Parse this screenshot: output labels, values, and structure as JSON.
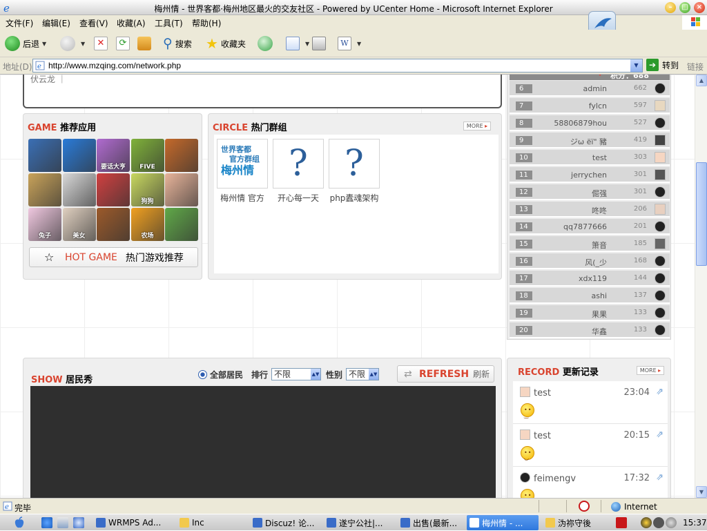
{
  "window": {
    "title": "梅州情 - 世界客都·梅州地区最火的交友社区 - Powered by UCenter Home - Microsoft Internet Explorer"
  },
  "menu": [
    "文件(F)",
    "编辑(E)",
    "查看(V)",
    "收藏(A)",
    "工具(T)",
    "帮助(H)"
  ],
  "toolbar": {
    "back": "后退",
    "search": "搜索",
    "favorites": "收藏夹"
  },
  "address": {
    "label": "地址(D)",
    "url": "http://www.mzqing.com/network.php",
    "go": "转到",
    "links": "链接"
  },
  "page": {
    "top_fragment": "伏云龙 ｜",
    "game": {
      "title_en": "GAME",
      "title_cn": "推荐应用",
      "tiles": [
        {
          "label": "",
          "color": "#3a6fb5"
        },
        {
          "label": "",
          "color": "#2a7bd8"
        },
        {
          "label": "要话大亨",
          "color": "#b06bd0"
        },
        {
          "label": "FIVE",
          "color": "#7fb13a"
        },
        {
          "label": "",
          "color": "#c4692a"
        },
        {
          "label": "",
          "color": "#c9a35a"
        },
        {
          "label": "",
          "color": "#d8d8d8"
        },
        {
          "label": "",
          "color": "#d04040"
        },
        {
          "label": "狗狗",
          "color": "#c8d860"
        },
        {
          "label": "",
          "color": "#e8b49a"
        },
        {
          "label": "兔子",
          "color": "#f0c8e0"
        },
        {
          "label": "美女",
          "color": "#e0d0c0"
        },
        {
          "label": "",
          "color": "#9c5a2a"
        },
        {
          "label": "农场",
          "color": "#f0a020"
        },
        {
          "label": "",
          "color": "#60a848"
        }
      ],
      "hot_en": "HOT GAME",
      "hot_cn": "热门游戏推荐"
    },
    "circle": {
      "title_en": "CIRCLE",
      "title_cn": "热门群组",
      "more": "MORE",
      "groups": [
        {
          "name": "梅州情 官方",
          "logo_line1": "世界客都",
          "logo_line2": "官方群组",
          "logo_line3": "梅州情"
        },
        {
          "name": "开心每一天"
        },
        {
          "name": "php蠹魂架构"
        }
      ]
    },
    "ranking": {
      "header": "积分：688",
      "rows": [
        {
          "rank": "6",
          "name": "admin",
          "score": "662"
        },
        {
          "rank": "7",
          "name": "fylcn",
          "score": "597"
        },
        {
          "rank": "8",
          "name": "58806879hou",
          "score": "527"
        },
        {
          "rank": "9",
          "name": "ジω ëï\" 豬",
          "score": "419"
        },
        {
          "rank": "10",
          "name": "test",
          "score": "303"
        },
        {
          "rank": "11",
          "name": "jerrychen",
          "score": "301"
        },
        {
          "rank": "12",
          "name": "倔强",
          "score": "301"
        },
        {
          "rank": "13",
          "name": "咚咚",
          "score": "206"
        },
        {
          "rank": "14",
          "name": "qq7877666",
          "score": "201"
        },
        {
          "rank": "15",
          "name": "箫音",
          "score": "185"
        },
        {
          "rank": "16",
          "name": "风(_少",
          "score": "168"
        },
        {
          "rank": "17",
          "name": "xdx119",
          "score": "144"
        },
        {
          "rank": "18",
          "name": "ashi",
          "score": "137"
        },
        {
          "rank": "19",
          "name": "果果",
          "score": "133"
        },
        {
          "rank": "20",
          "name": "华鑫",
          "score": "133"
        }
      ]
    },
    "show": {
      "title_en": "SHOW",
      "title_cn": "居民秀",
      "all_residents": "全部居民",
      "rank_label": "排行",
      "rank_value": "不限",
      "gender_label": "性别",
      "gender_value": "不限",
      "refresh_en": "REFRESH",
      "refresh_cn": "刷新"
    },
    "record": {
      "title_en": "RECORD",
      "title_cn": "更新记录",
      "more": "MORE",
      "items": [
        {
          "name": "test",
          "time": "23:04"
        },
        {
          "name": "test",
          "time": "20:15"
        },
        {
          "name": "feimengv",
          "time": "17:32"
        }
      ]
    }
  },
  "status": {
    "text": "完毕",
    "zone": "Internet"
  },
  "taskbar": {
    "tasks": [
      "WRMPS Ad...",
      "Inc",
      "Discuz! 论...",
      "遂宁公社|...",
      "出售(最新...",
      "梅州情 - ...",
      "沩祢守後"
    ],
    "clock": "15:37"
  }
}
